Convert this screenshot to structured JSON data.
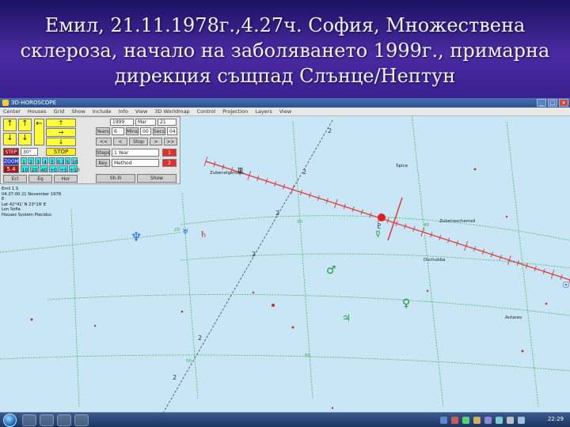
{
  "slide": {
    "title_lines": [
      "Емил, 21.11.1978г.,4.27ч. София, Множествена",
      "склероза, начало на заболяването 1999г., примарна",
      "дирекция същпад Слънце/Нептун"
    ]
  },
  "window": {
    "title": "3D-HOROSCOPE",
    "menu": [
      "Center",
      "Houses",
      "Grid",
      "Show",
      "Include",
      "Info",
      "View",
      "3D Worldmap",
      "Control",
      "Projection",
      "Layers",
      "View"
    ]
  },
  "panel": {
    "year": "1999",
    "month": "Mar",
    "day": "21",
    "arrows": [
      "↑",
      "↑",
      "↑",
      "←",
      "→",
      "↓",
      "↓",
      "↓"
    ],
    "step_labels": [
      "Years",
      "Mins",
      "Secs"
    ],
    "step_values": [
      "6",
      "00",
      "00",
      "04"
    ],
    "nav_buttons": [
      "<<",
      "<",
      "Stop",
      ">",
      ">>"
    ],
    "stop_label": "STOP",
    "step_btn": "STEP",
    "zoom_label": "ZOOM",
    "zoom_value": "5.4",
    "degree_value": "30°",
    "speed_values": [
      "1",
      "2",
      "3",
      "4",
      "5",
      "0.1",
      "5",
      "10",
      "10",
      "20",
      "40",
      "+0.1",
      "+5",
      "+10"
    ],
    "steps_label": "Steps",
    "steps_value": "1 Year",
    "key_label": "Key",
    "key_value": "Method",
    "check_labels": [
      "Ecl",
      "Eq",
      "Hor"
    ],
    "bottom_buttons": [
      "Sh.Ili",
      "Show"
    ],
    "red_vals": [
      "1",
      "2"
    ]
  },
  "readout": {
    "lines": [
      "Emil 1 S",
      "04:27:00   21 November 1978",
      "E",
      "Lat 42°41' N 23°19' E",
      "Lon Sofia",
      "Houses System Placidus"
    ]
  },
  "sky": {
    "grid_labels": [
      "2",
      "2",
      "2",
      "2",
      "2",
      "2",
      "2",
      "2"
    ],
    "constellation_labels": [
      "Zubenelgenubi",
      "Zubeneschamali",
      "Antares",
      "Dschubba",
      "Spica"
    ],
    "planet_symbols": [
      "♆",
      "♂",
      "♀",
      "☿",
      "♃",
      "♄",
      "♅",
      "☉",
      "♇",
      "♏"
    ],
    "scale_labels": [
      "20",
      "30",
      "40",
      "50",
      "60"
    ]
  },
  "taskbar": {
    "clock": "22:29"
  },
  "colors": {
    "sky_bg": "#c8e6f6",
    "ecliptic": "#e03030",
    "grid_green": "#3aa84a",
    "planet_blue": "#2a6ad0",
    "planet_green": "#1a9a3a",
    "slide_bg": "#3a2090"
  }
}
